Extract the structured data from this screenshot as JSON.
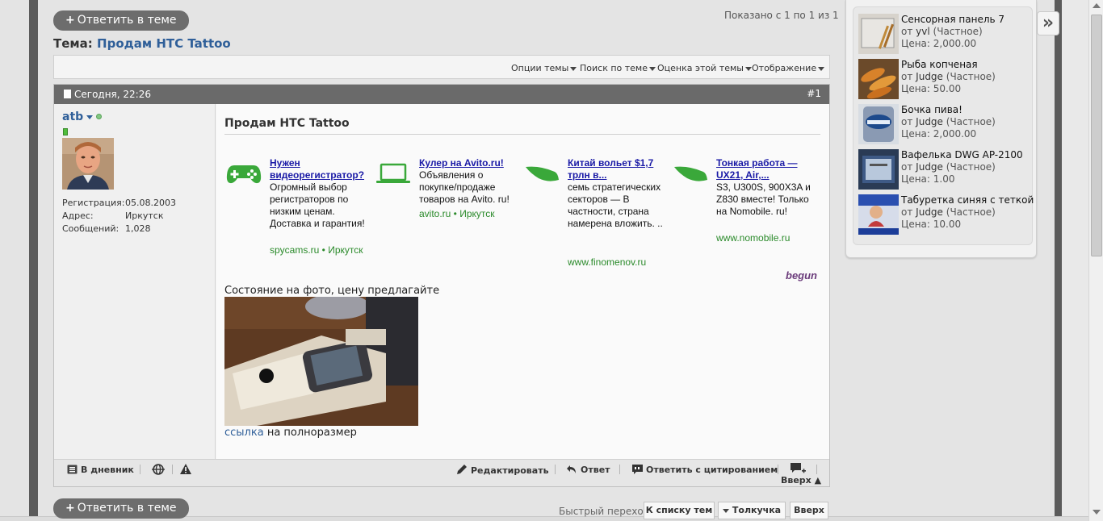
{
  "thread": {
    "reply_label": "Ответить в теме",
    "shown_text": "Показано с 1 по 1 из 1",
    "title_prefix": "Тема:",
    "title_link": "Продам HTC Tattoo"
  },
  "toolbar": {
    "items": [
      "Опции темы",
      "Поиск по теме",
      "Оценка этой темы",
      "Отображение"
    ]
  },
  "post": {
    "date": "Сегодня, 22:26",
    "number": "#1",
    "user": {
      "name": "atb",
      "reg_label": "Регистрация:",
      "reg_value": "05.08.2003",
      "addr_label": "Адрес:",
      "addr_value": "Иркутск",
      "msgs_label": "Сообщений:",
      "msgs_value": "1,028"
    },
    "title": "Продам HTC Tattoo",
    "ads": [
      {
        "icon": "gamepad-icon",
        "title": "Нужен видеорегистратор?",
        "text": "Огромный выбор регистраторов по низким ценам. Доставка и гарантия!",
        "url": "spycams.ru • Иркутск"
      },
      {
        "icon": "laptop-icon",
        "title": "Кулер на Avito.ru!",
        "text": "Объявления о покупке/продаже товаров на Avito. ru!",
        "url": "avito.ru • Иркутск"
      },
      {
        "icon": "leaf-icon",
        "title": "Китай вольет $1,7 трлн в...",
        "text": "семь стратегических секторов — В частности, страна намерена вложить. ..",
        "url": "www.finomenov.ru"
      },
      {
        "icon": "leaf-icon",
        "title": "Тонкая работа — UX21, Air,...",
        "text": "S3, U300S, 900X3A и Z830 вместе! Только на Nomobile. ru!",
        "url": "www.nomobile.ru"
      }
    ],
    "ads_brand": "begun",
    "body_text": "Состояние на фото, цену предлагайте",
    "link_text": "ссылка",
    "link_suffix": " на полноразмер",
    "footer": {
      "diary": "В дневник",
      "edit": "Редактировать",
      "reply": "Ответ",
      "quote": "Ответить с цитированием",
      "top": "Вверх ▲"
    }
  },
  "bottom": {
    "reply_label": "Ответить в теме",
    "quick_nav": "Быстрый переход",
    "to_list": "К списку тем",
    "pushpin": "Толкучка",
    "up": "Вверх"
  },
  "sidebar": {
    "collapse_icon": "»",
    "items": [
      {
        "title": "Сенсорная панель 7",
        "by": "от",
        "author": "yvl",
        "kind": "(Частное)",
        "price": "Цена: 2,000.00"
      },
      {
        "title": "Рыба копченая",
        "by": "от",
        "author": "Judge",
        "kind": "(Частное)",
        "price": "Цена: 50.00"
      },
      {
        "title": "Бочка пива!",
        "by": "от",
        "author": "Judge",
        "kind": "(Частное)",
        "price": "Цена: 2,000.00"
      },
      {
        "title": "Вафелька DWG AP-2100",
        "by": "от",
        "author": "Judge",
        "kind": "(Частное)",
        "price": "Цена: 1.00"
      },
      {
        "title": "Табуретка синяя с теткой",
        "by": "от",
        "author": "Judge",
        "kind": "(Частное)",
        "price": "Цена: 10.00"
      }
    ]
  }
}
